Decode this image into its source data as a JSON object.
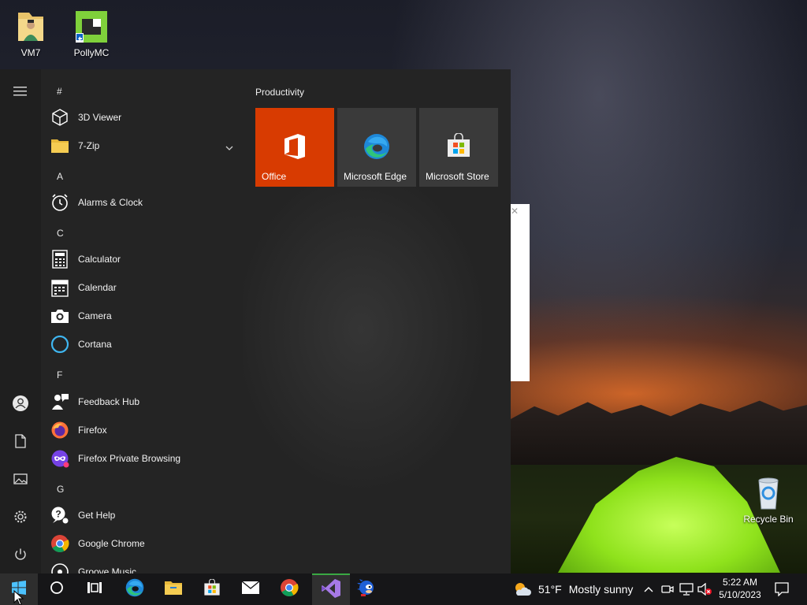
{
  "desktop": {
    "icons": [
      {
        "label": "VM7"
      },
      {
        "label": "PollyMC"
      },
      {
        "label": "Recycle Bin"
      }
    ]
  },
  "start_menu": {
    "rail": {
      "items": [
        {
          "name": "hamburger-menu-icon"
        },
        {
          "name": "user-account-icon"
        },
        {
          "name": "documents-icon"
        },
        {
          "name": "pictures-icon"
        },
        {
          "name": "settings-icon"
        },
        {
          "name": "power-icon"
        }
      ]
    },
    "app_list": {
      "groups": [
        "#",
        "A",
        "C",
        "F",
        "G"
      ],
      "apps": [
        {
          "label": "3D Viewer",
          "icon": "cube-icon"
        },
        {
          "label": "7-Zip",
          "icon": "folder-icon"
        },
        {
          "label": "Alarms & Clock",
          "icon": "clock-icon"
        },
        {
          "label": "Calculator",
          "icon": "calculator-icon"
        },
        {
          "label": "Calendar",
          "icon": "calendar-icon"
        },
        {
          "label": "Camera",
          "icon": "camera-icon"
        },
        {
          "label": "Cortana",
          "icon": "cortana-icon"
        },
        {
          "label": "Feedback Hub",
          "icon": "feedback-icon"
        },
        {
          "label": "Firefox",
          "icon": "firefox-icon"
        },
        {
          "label": "Firefox Private Browsing",
          "icon": "firefox-private-icon"
        },
        {
          "label": "Get Help",
          "icon": "help-icon"
        },
        {
          "label": "Google Chrome",
          "icon": "chrome-icon"
        },
        {
          "label": "Groove Music",
          "icon": "music-icon"
        }
      ]
    },
    "tiles": {
      "group_title": "Productivity",
      "items": [
        {
          "label": "Office",
          "color": "#d83b01"
        },
        {
          "label": "Microsoft Edge",
          "color": "#3a3a3a"
        },
        {
          "label": "Microsoft Store",
          "color": "#3a3a3a"
        }
      ]
    }
  },
  "taskbar": {
    "weather": {
      "temp": "51°F",
      "condition": "Mostly sunny"
    },
    "clock": {
      "time": "5:22 AM",
      "date": "5/10/2023"
    }
  },
  "colors": {
    "accent": "#0078d7",
    "office_orange": "#d83b01",
    "start_bg": "#242424",
    "taskbar_bg": "#161618"
  }
}
